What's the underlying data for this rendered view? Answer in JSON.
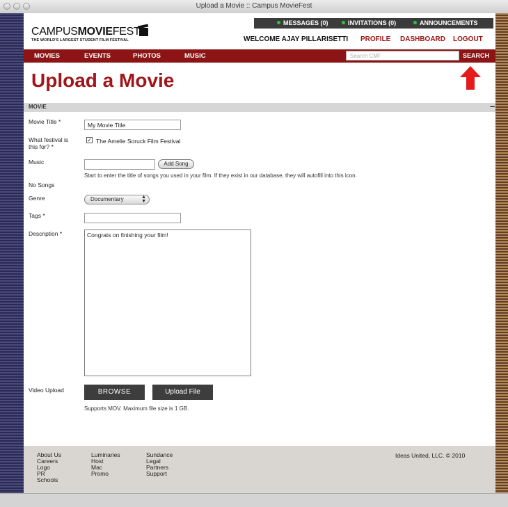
{
  "window": {
    "title": "Upload a Movie :: Campus MovieFest"
  },
  "utility": {
    "messages": "MESSAGES (0)",
    "invitations": "INVITATIONS (0)",
    "announcements": "ANNOUNCEMENTS"
  },
  "logo": {
    "campus": "CAMPUS",
    "movie": "MOVIE",
    "fest": "FEST",
    "tagline": "THE WORLD'S LARGEST STUDENT FILM FESTIVAL"
  },
  "user": {
    "welcome": "WELCOME AJAY PILLARISETTI",
    "profile": "PROFILE",
    "dashboard": "DASHBOARD",
    "logout": "LOGOUT"
  },
  "nav": {
    "movies": "MOVIES",
    "events": "EVENTS",
    "photos": "PHOTOS",
    "music": "MUSIC"
  },
  "search": {
    "placeholder": "Search CMF",
    "button": "SEARCH"
  },
  "page": {
    "title": "Upload a Movie"
  },
  "section": {
    "label": "MOVIE",
    "collapse": "–"
  },
  "form": {
    "movie_title_label": "Movie Title *",
    "movie_title_value": "My Movie Title",
    "festival_label": "What festival is this for? *",
    "festival_option": "The Amelie Soruck Film Festival",
    "festival_checked": true,
    "music_label": "Music",
    "music_value": "",
    "add_song_label": "Add Song",
    "music_help": "Start to enter the title of songs you used in your film. If they exist in our database, they will autofill into this icon.",
    "no_songs": "No Songs",
    "genre_label": "Genre",
    "genre_value": "Documentary",
    "tags_label": "Tags *",
    "tags_value": "",
    "description_label": "Description *",
    "description_value": "Congrats on finishing your film!",
    "video_upload_label": "Video Upload",
    "browse_label": "BROWSE",
    "upload_file_label": "Upload File",
    "upload_help": "Supports MOV. Maximum file size is 1 GB."
  },
  "footer": {
    "col1": [
      "About Us",
      "Careers",
      "Logo",
      "PR",
      "Schools"
    ],
    "col2": [
      "Luminaries",
      "Host",
      "Mac",
      "Promo"
    ],
    "col3": [
      "Sundance",
      "Legal",
      "Partners",
      "Support"
    ],
    "copyright": "Ideas United, LLC. © 2010"
  },
  "colors": {
    "brand_red": "#9c1515",
    "nav_bg": "#8c1414",
    "util_bg": "#3b3b3b",
    "status_green": "#2fc33b"
  }
}
